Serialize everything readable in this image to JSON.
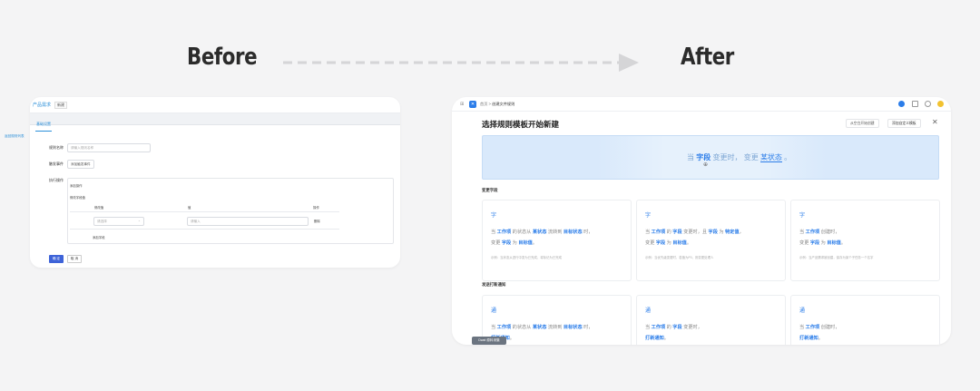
{
  "headings": {
    "before": "Before",
    "after": "After"
  },
  "before": {
    "title": "产品需求",
    "badge": "新建",
    "tab": "基础设置",
    "back_link": "返回规则列表",
    "fields": [
      {
        "label": "规则名称",
        "placeholder": "请输入规则名称"
      },
      {
        "label": "触发事件",
        "value": "添加触发事件"
      },
      {
        "label": "执行操作",
        "value": ""
      }
    ],
    "action_link": "添加操作",
    "section_title": "修改字段值",
    "table_headers": [
      "修改值",
      "值",
      "操作"
    ],
    "row": {
      "select_placeholder": "请选择",
      "input_placeholder": "请输入",
      "action": "删除"
    },
    "add_field": "添加字段",
    "submit": "确 定",
    "cancel": "取 消"
  },
  "after": {
    "crumb_home": "首页",
    "crumb_current": "创建文件规则",
    "page_title": "选择规则模板开始新建",
    "btn_blank": "从空白开始创建",
    "btn_custom": "添加自定义模板",
    "banner": {
      "t1": "当",
      "t2": "字段",
      "t3": "变更时，",
      "t4": "变更",
      "t5": "某状态",
      "t6": "。"
    },
    "section1": "变更字段",
    "section2": "发送打新通知",
    "cards_row1": [
      {
        "icon": "字",
        "l1": [
          "当 ",
          "工作项",
          " 的状态从 ",
          "某状态",
          " 流转到 ",
          "目标状态",
          " 时，"
        ],
        "l2": [
          "变更 ",
          "字段",
          " 为 ",
          "目标值",
          "。"
        ],
        "note": "示例：当状态从进行中变为已完成，将标记为已完成"
      },
      {
        "icon": "字",
        "l1": [
          "当 ",
          "工作项",
          " 的 ",
          "字段",
          " 变更时，且 ",
          "字段",
          " 为 ",
          "特定值",
          "，"
        ],
        "l2": [
          "变更 ",
          "字段",
          " 为 ",
          "目标值",
          "。"
        ],
        "note": "示例：当优先级变更时，若值为P0，则变更处理人"
      },
      {
        "icon": "字",
        "l1": [
          "当 ",
          "工作项",
          " 创建时，"
        ],
        "l2": [
          "变更 ",
          "字段",
          " 为 ",
          "目标值",
          "。"
        ],
        "note": "示例：当产品需求被创建，保存为某个子任务一个名字"
      }
    ],
    "cards_row2": [
      {
        "icon": "通",
        "l1": [
          "当 ",
          "工作项",
          " 的状态从 ",
          "某状态",
          " 流转到 ",
          "目标状态",
          " 时，"
        ],
        "l2": [
          "",
          "打新通知",
          "。"
        ]
      },
      {
        "icon": "通",
        "l1": [
          "当 ",
          "工作项",
          " 的 ",
          "字段",
          " 变更时，"
        ],
        "l2": [
          "",
          "打新通知",
          "。"
        ]
      },
      {
        "icon": "通",
        "l1": [
          "当 ",
          "工作项",
          " 创建时，"
        ],
        "l2": [
          "",
          "打新通知",
          "。"
        ]
      }
    ],
    "pill": "Dwal·原料采集"
  },
  "colors": {
    "accent": "#2b7de9",
    "before_accent": "#2b8fd9",
    "primary_button": "#3e63d8"
  }
}
